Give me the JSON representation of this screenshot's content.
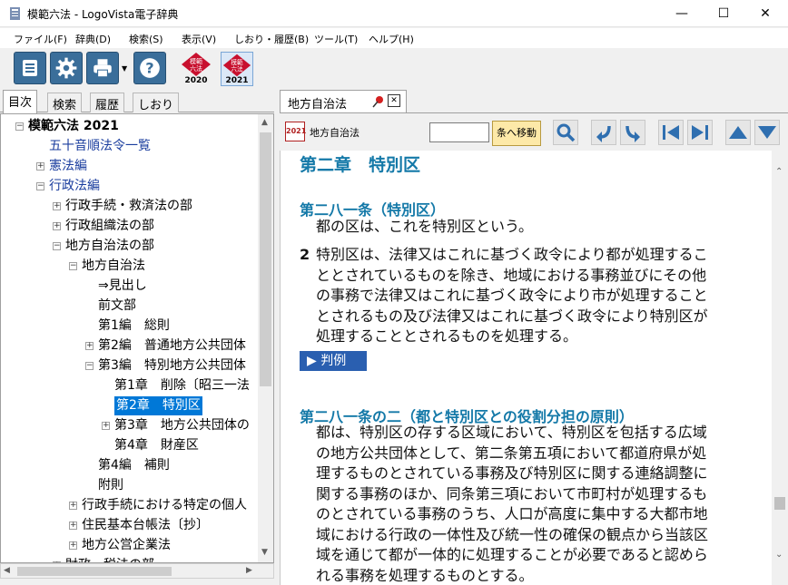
{
  "window": {
    "title": "模範六法 - LogoVista電子辞典",
    "minimize": "—",
    "maximize": "☐",
    "close": "✕"
  },
  "menu": [
    "ファイル(F)",
    "辞典(D)",
    "検索(S)",
    "表示(V)",
    "しおり・履歴(B)",
    "ツール(T)",
    "ヘルプ(H)"
  ],
  "toolbar": {
    "seal1_year": "2020",
    "seal2_year": "2021",
    "seal_text": "模範六法"
  },
  "left_tabs": [
    "目次",
    "検索",
    "履歴",
    "しおり"
  ],
  "tree": [
    {
      "label": "模範六法 2021",
      "indent": 0,
      "exp": "−",
      "bold": true,
      "blue": false
    },
    {
      "label": "五十音順法令一覧",
      "indent": 1,
      "exp": "",
      "blue": true
    },
    {
      "label": "憲法編",
      "indent": 1,
      "exp": "+",
      "blue": true
    },
    {
      "label": "行政法編",
      "indent": 1,
      "exp": "−",
      "blue": true
    },
    {
      "label": "行政手続・救済法の部",
      "indent": 2,
      "exp": "+"
    },
    {
      "label": "行政組織法の部",
      "indent": 2,
      "exp": "+"
    },
    {
      "label": "地方自治法の部",
      "indent": 2,
      "exp": "−"
    },
    {
      "label": "地方自治法",
      "indent": 3,
      "exp": "−"
    },
    {
      "label": "⇒見出し",
      "indent": 4,
      "exp": ""
    },
    {
      "label": "前文部",
      "indent": 4,
      "exp": ""
    },
    {
      "label": "第1編　総則",
      "indent": 4,
      "exp": ""
    },
    {
      "label": "第2編　普通地方公共団体",
      "indent": 4,
      "exp": "+"
    },
    {
      "label": "第3編　特別地方公共団体",
      "indent": 4,
      "exp": "−"
    },
    {
      "label": "第1章　削除〔昭三一法",
      "indent": 5,
      "exp": ""
    },
    {
      "label": "第2章　特別区",
      "indent": 5,
      "exp": "",
      "sel": true
    },
    {
      "label": "第3章　地方公共団体の",
      "indent": 5,
      "exp": "+"
    },
    {
      "label": "第4章　財産区",
      "indent": 5,
      "exp": ""
    },
    {
      "label": "第4編　補則",
      "indent": 4,
      "exp": ""
    },
    {
      "label": "附則",
      "indent": 4,
      "exp": ""
    },
    {
      "label": "行政手続における特定の個人",
      "indent": 3,
      "exp": "+"
    },
    {
      "label": "住民基本台帳法〔抄〕",
      "indent": 3,
      "exp": "+"
    },
    {
      "label": "地方公営企業法",
      "indent": 3,
      "exp": "+"
    },
    {
      "label": "財政・税法の部",
      "indent": 2,
      "exp": "+"
    }
  ],
  "doc_tab": {
    "label": "地方自治法",
    "close": "✕"
  },
  "subtoolbar": {
    "badge": "2021",
    "law_name": "地方自治法",
    "jump_button": "条へ移動",
    "jump_value": ""
  },
  "content": {
    "chapter": "第二章　特別区",
    "art1_title": "第二八一条（特別区）",
    "art1_p1": "都の区は、これを特別区という。",
    "art1_p2_num": "2",
    "art1_p2_lines": [
      "特別区は、法律又はこれに基づく政令により都が処理するこ",
      "ととされているものを除き、地域における事務並びにその他",
      "の事務で法律又はこれに基づく政令により市が処理すること",
      "とされるもの及び法律又はこれに基づく政令により特別区が",
      "処理することとされるものを処理する。"
    ],
    "hanrei": "▶ 判例",
    "art2_title": "第二八一条の二（都と特別区との役割分担の原則）",
    "art2_lines": [
      "都は、特別区の存する区域において、特別区を包括する広域",
      "の地方公共団体として、第二条第五項において都道府県が処",
      "理するものとされている事務及び特別区に関する連絡調整に",
      "関する事務のほか、同条第三項において市町村が処理するも",
      "のとされている事務のうち、人口が高度に集中する大都市地",
      "域における行政の一体性及び統一性の確保の観点から当該区",
      "域を通じて都が一体的に処理することが必要であると認めら",
      "れる事務を処理するものとする。"
    ]
  }
}
